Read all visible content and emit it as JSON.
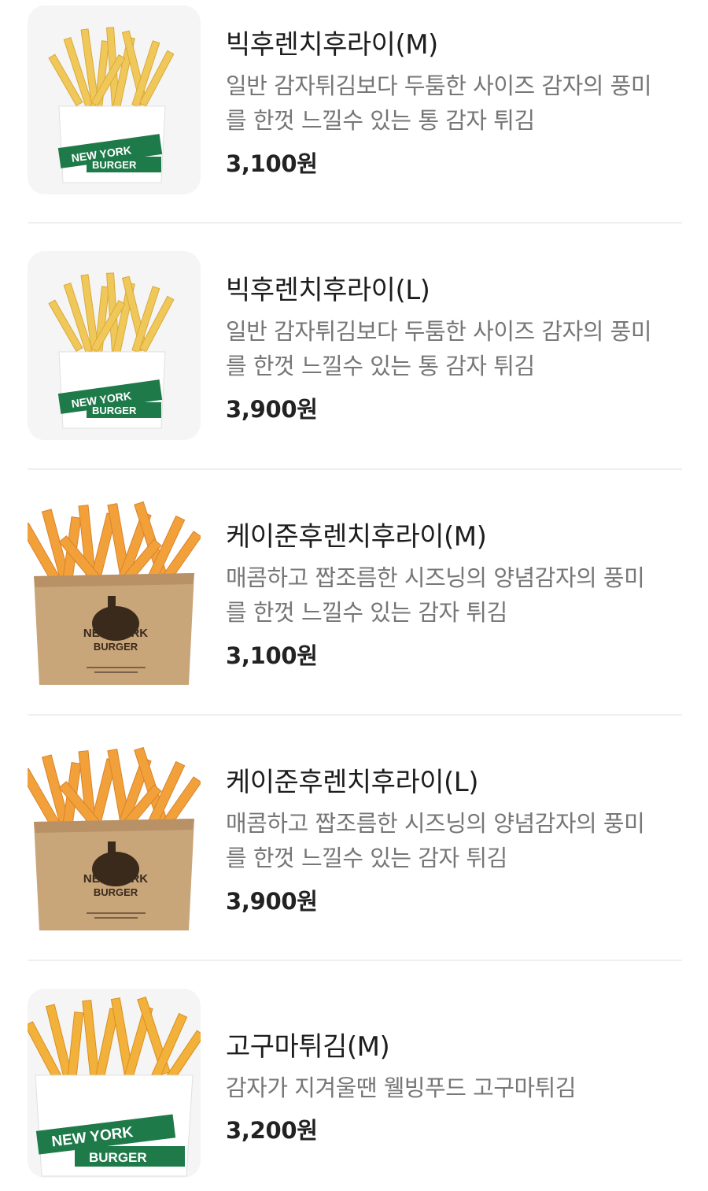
{
  "menu": {
    "items": [
      {
        "name": "빅후렌치후라이(M)",
        "desc_line1": "일반 감자튀김보다 두툼한 사이즈 감자의 풍미",
        "desc_line2": "를 한껏 느낄수 있는 통 감자 튀김",
        "price": "3,100원",
        "image": "fries-white-box",
        "box_text_1": "NEW YORK",
        "box_text_2": "BURGER"
      },
      {
        "name": "빅후렌치후라이(L)",
        "desc_line1": "일반 감자튀김보다 두툼한 사이즈 감자의 풍미",
        "desc_line2": "를 한껏 느낄수 있는 통 감자 튀김",
        "price": "3,900원",
        "image": "fries-white-box",
        "box_text_1": "NEW YORK",
        "box_text_2": "BURGER"
      },
      {
        "name": "케이준후렌치후라이(M)",
        "desc_line1": "매콤하고 짭조름한 시즈닝의 양념감자의 풍미",
        "desc_line2": "를 한껏 느낄수 있는 감자 튀김",
        "price": "3,100원",
        "image": "cajun-fries-kraft-bag",
        "box_text_1": "NEW YORK",
        "box_text_2": "BURGER"
      },
      {
        "name": "케이준후렌치후라이(L)",
        "desc_line1": "매콤하고 짭조름한 시즈닝의 양념감자의 풍미",
        "desc_line2": "를 한껏 느낄수 있는 감자 튀김",
        "price": "3,900원",
        "image": "cajun-fries-kraft-bag",
        "box_text_1": "NEW YORK",
        "box_text_2": "BURGER"
      },
      {
        "name": "고구마튀김(M)",
        "desc_line1": "감자가 지겨울땐 웰빙푸드 고구마튀김",
        "price": "3,200원",
        "image": "sweet-potato-fries-white-box",
        "box_text_1": "NEW YORK",
        "box_text_2": "BURGER"
      }
    ]
  },
  "colors": {
    "brand_green": "#1f7a4a",
    "fry_yellow": "#f0c85a",
    "fry_orange": "#f2a13a",
    "kraft": "#c9a57a",
    "text_primary": "#1d1d1d",
    "text_secondary": "#767676",
    "divider": "#efefef"
  }
}
